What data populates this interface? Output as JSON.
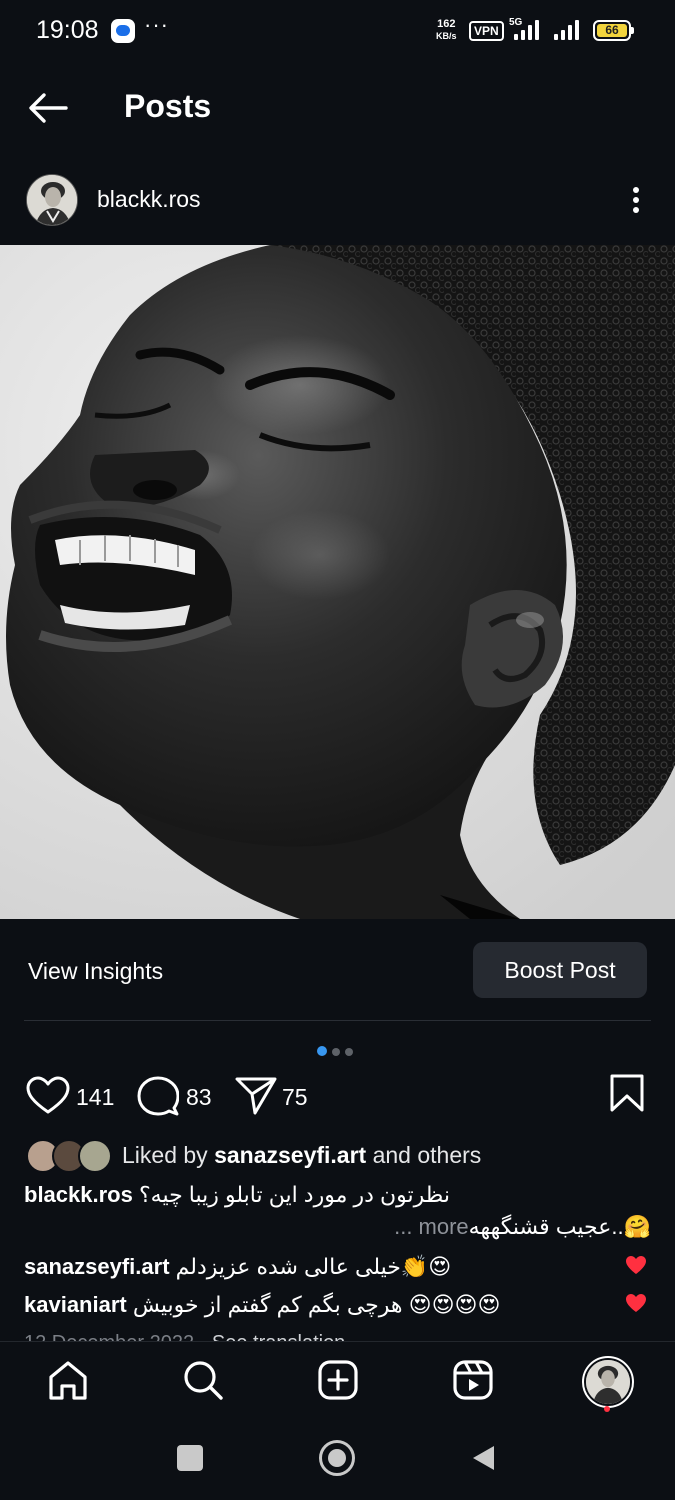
{
  "status_bar": {
    "time": "19:08",
    "dots": "···",
    "speed_value": "162",
    "speed_unit": "KB/s",
    "vpn": "VPN",
    "network": "5G",
    "battery": "66"
  },
  "header": {
    "title": "Posts"
  },
  "post": {
    "username": "blackk.ros",
    "view_insights": "View Insights",
    "boost_post": "Boost Post",
    "carousel": {
      "count": 3,
      "active": 0
    },
    "likes_count": "141",
    "comments_count": "83",
    "shares_count": "75",
    "liked_by_prefix": "Liked by",
    "liked_by_user": "sanazseyfi.art",
    "liked_by_suffix": "and others",
    "caption_user": "blackk.ros",
    "caption_text": "نظرتون در مورد این تابلو زیبا چیه؟",
    "caption_text2": "عجیب قشنگههه..🤗",
    "more": "... more",
    "comments": [
      {
        "user": "sanazseyfi.art",
        "text": "خیلی عالی شده عزیزدلم👏😍"
      },
      {
        "user": "kavianiart",
        "text": "هرچی بگم کم گفتم از خوبیش 😍😍😍😍"
      }
    ],
    "date": "12 December 2022",
    "see_translation": "See translation"
  },
  "colors": {
    "background": "#0c0f14",
    "accent": "#3897f0",
    "heart": "#ff3040",
    "battery": "#f2d43d"
  },
  "icons": [
    "back-arrow-icon",
    "more-vertical-icon",
    "heart-icon",
    "comment-icon",
    "share-icon",
    "bookmark-icon",
    "home-icon",
    "search-icon",
    "create-icon",
    "reels-icon",
    "profile-icon"
  ]
}
